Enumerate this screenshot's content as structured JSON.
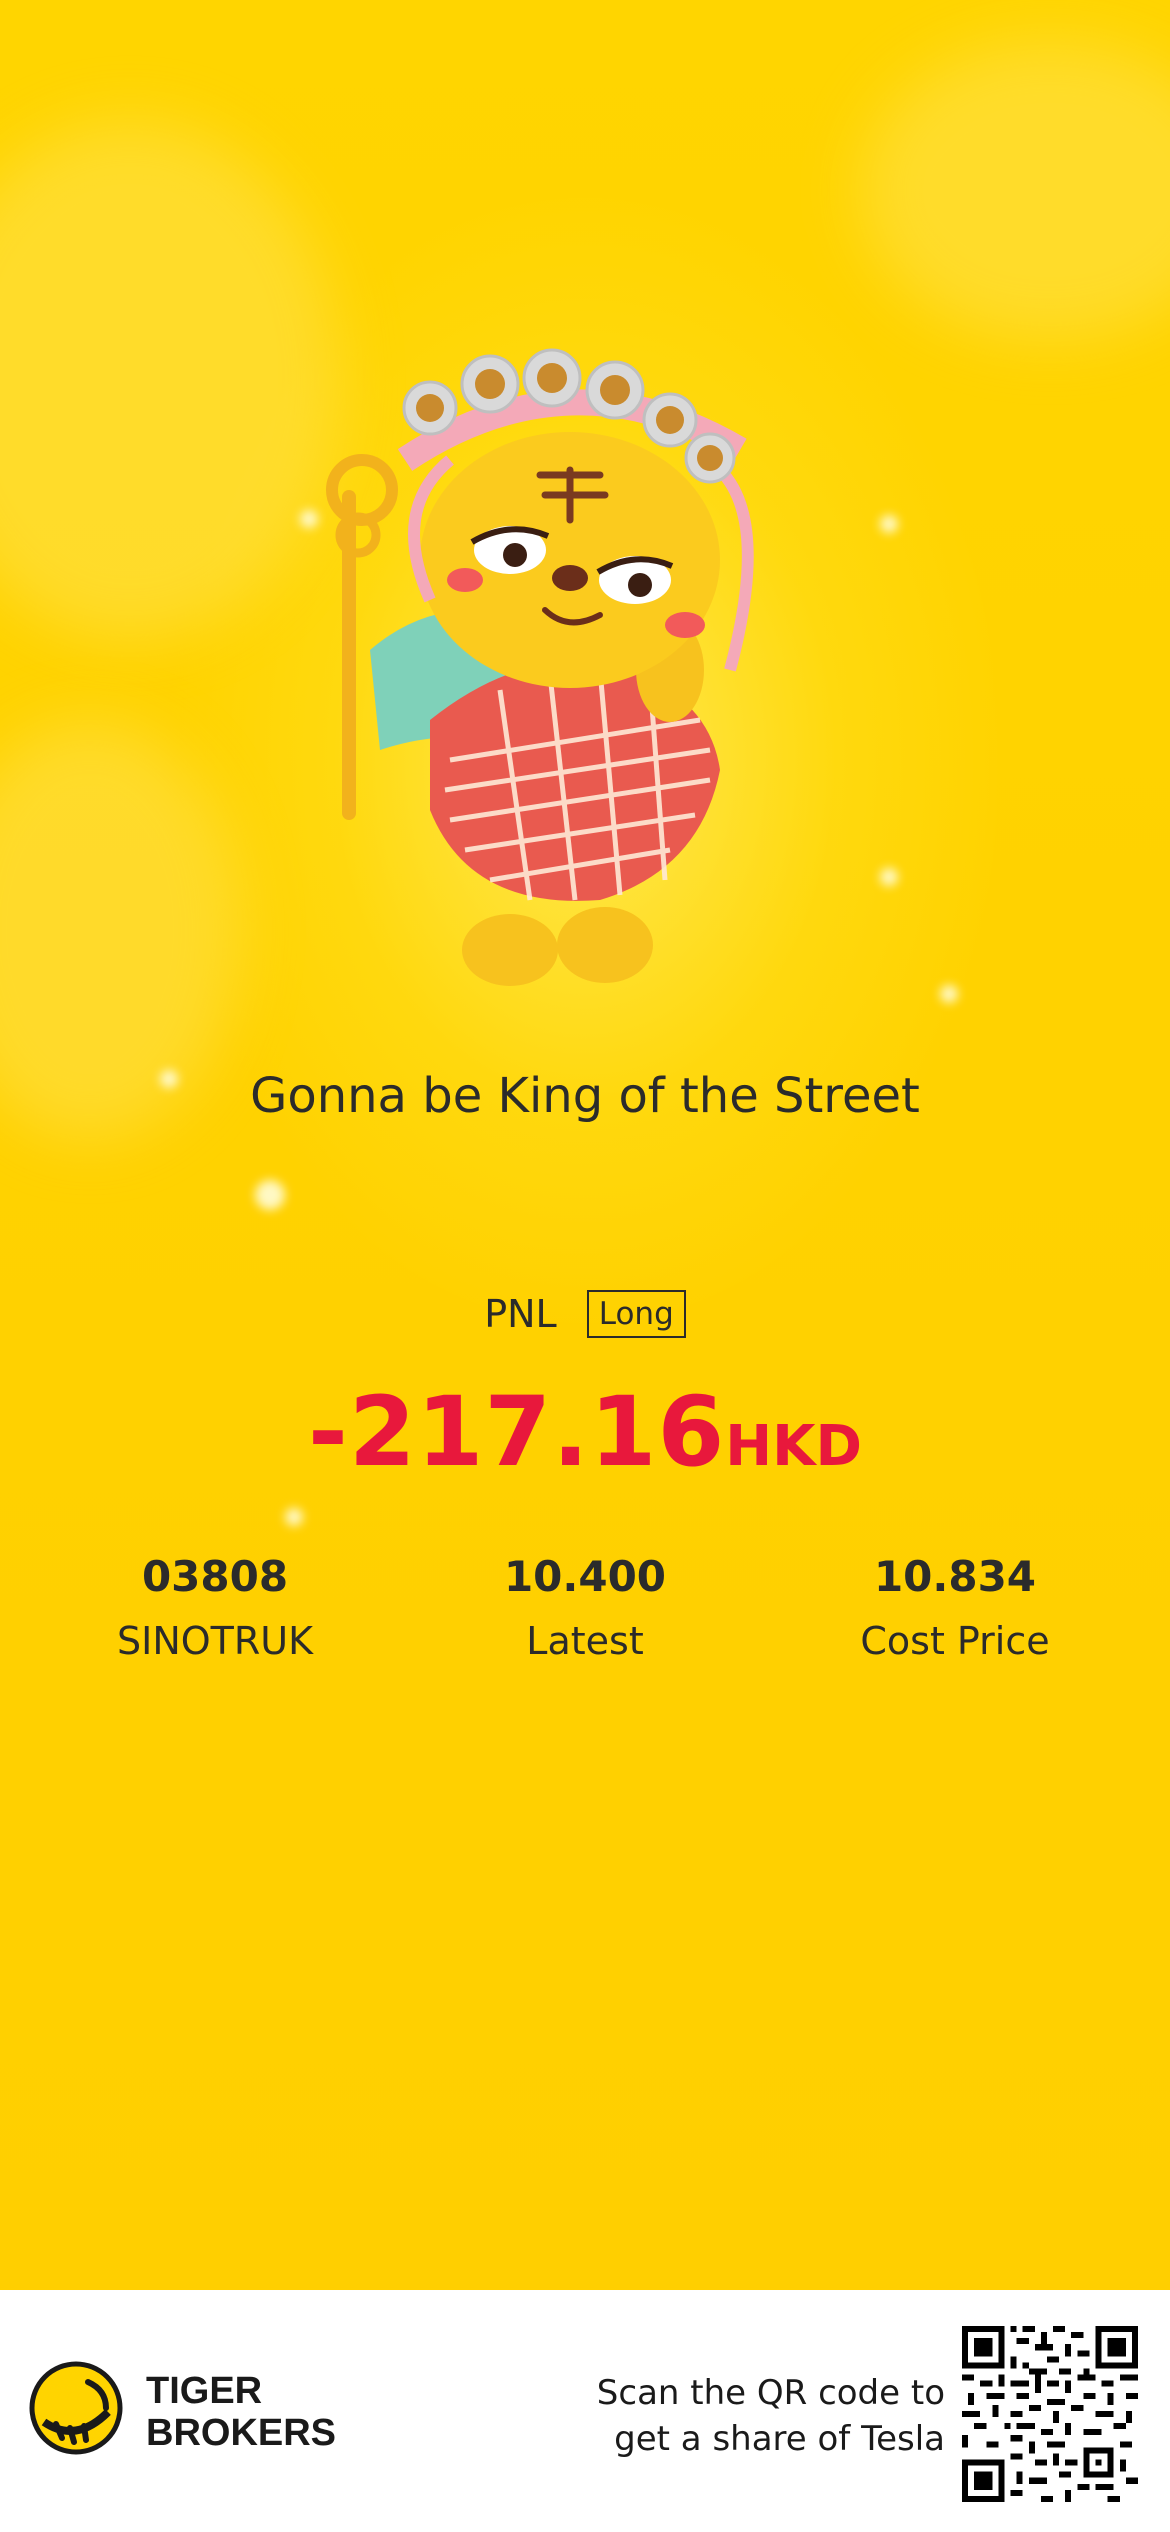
{
  "tagline": "Gonna be King of the Street",
  "pnl": {
    "label": "PNL",
    "direction_badge": "Long",
    "amount": "-217.16",
    "currency": "HKD",
    "color": "#E8183C"
  },
  "stats": [
    {
      "value": "03808",
      "label": "SINOTRUK"
    },
    {
      "value": "10.400",
      "label": "Latest"
    },
    {
      "value": "10.834",
      "label": "Cost Price"
    }
  ],
  "footer": {
    "brand_line1": "TIGER",
    "brand_line2": "BROKERS",
    "scan_line1": "Scan the QR code to",
    "scan_line2": "get a share of Tesla"
  },
  "colors": {
    "background": "#FFD400",
    "text": "#2B2B2B",
    "loss": "#E8183C"
  },
  "icons": {
    "mascot": "tiger-mascot-illustration",
    "logo": "tiger-brokers-logo-icon",
    "qr": "qr-code-icon"
  }
}
